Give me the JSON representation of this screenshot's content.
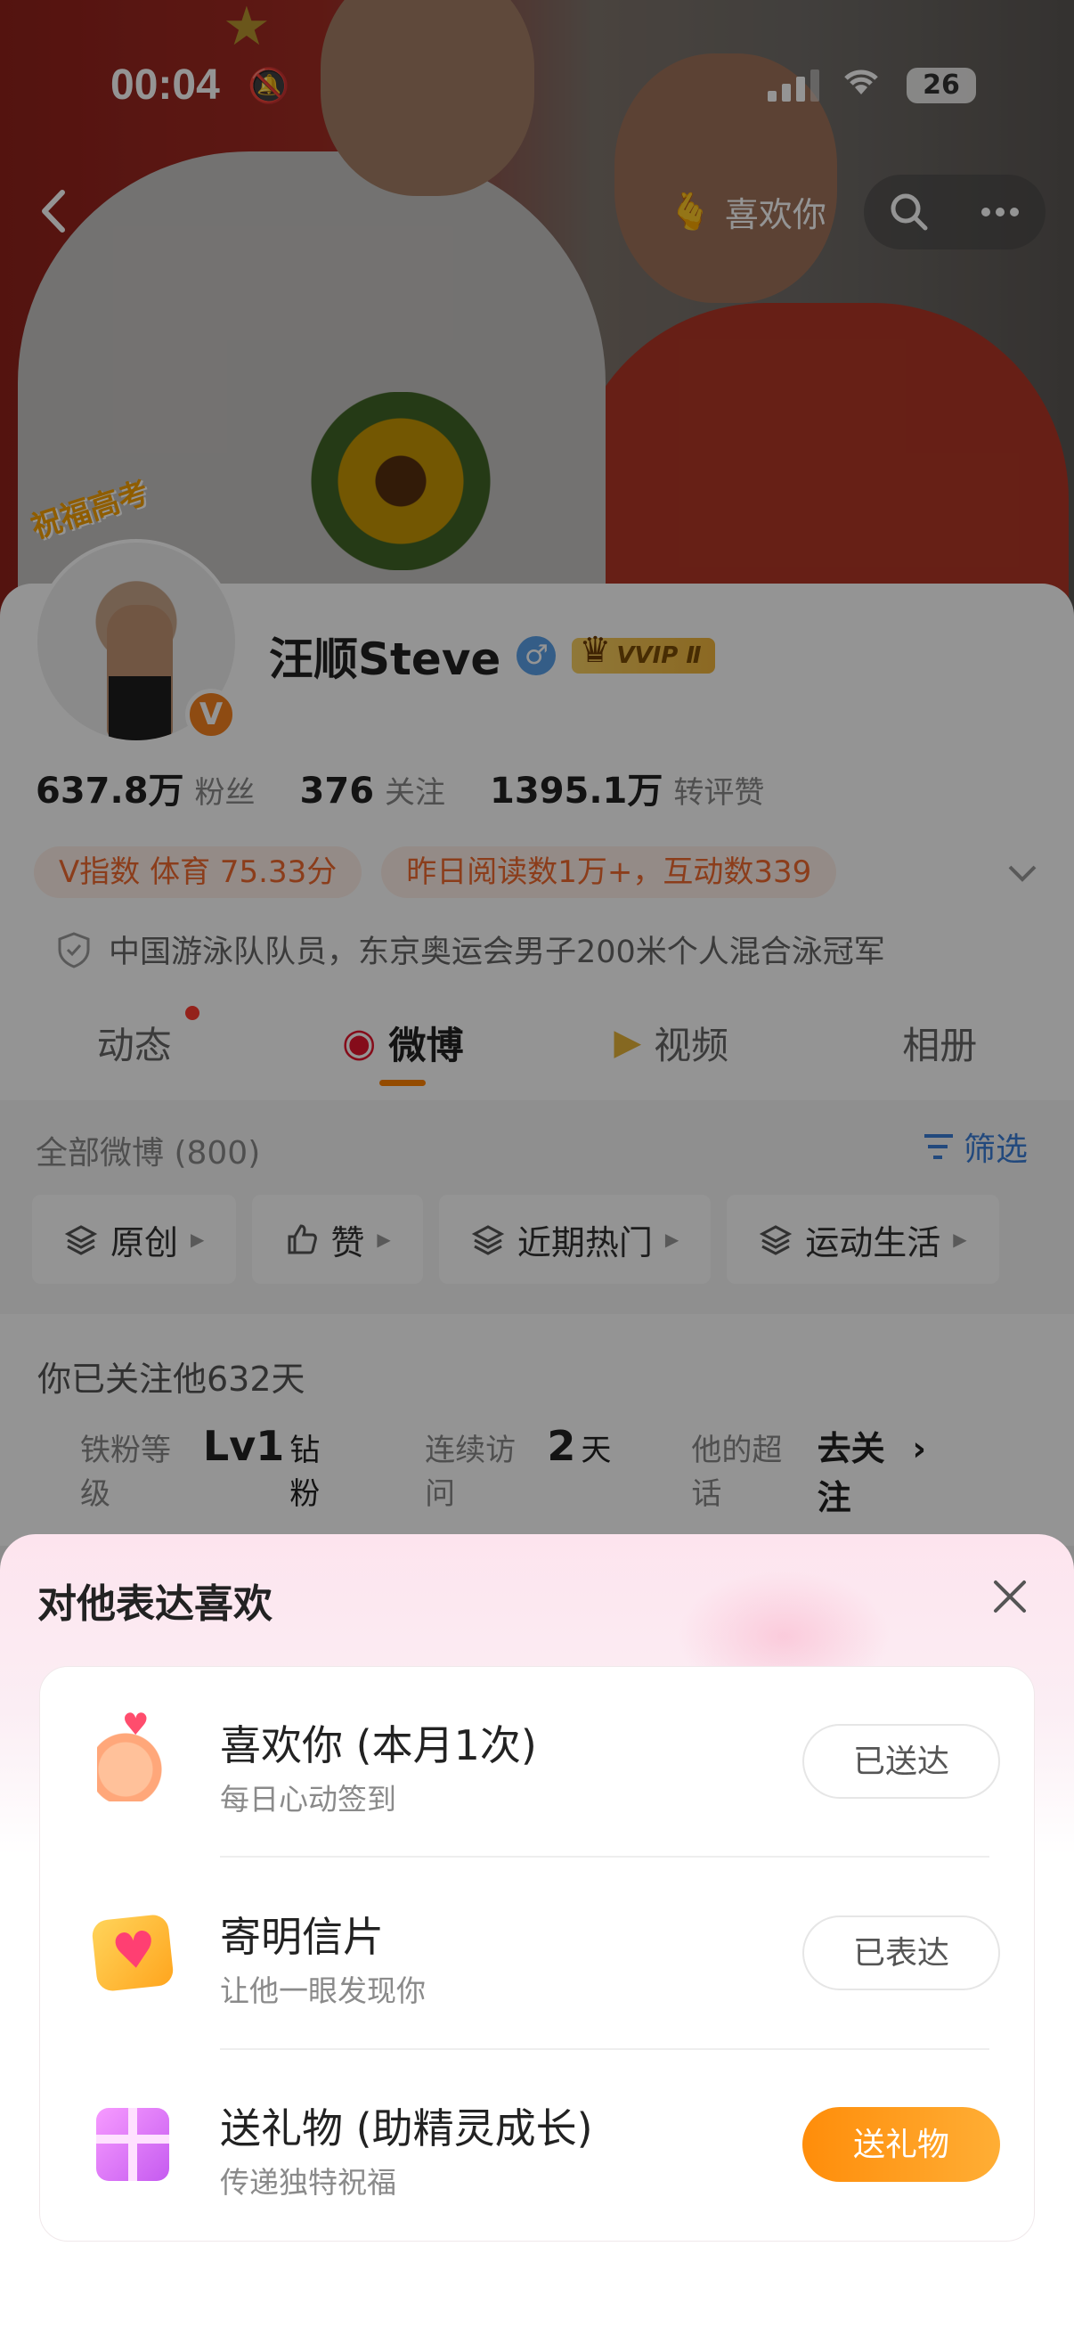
{
  "status_bar": {
    "time": "00:04",
    "battery": "26"
  },
  "header": {
    "like_label": "喜欢你"
  },
  "profile": {
    "avatar_tag": "祝福高考",
    "verified_badge": "V",
    "name": "汪顺Steve",
    "gender_symbol": "♂",
    "vip_label": "VVIP Ⅱ",
    "stats": [
      {
        "num": "637.8万",
        "label": "粉丝"
      },
      {
        "num": "376",
        "label": "关注"
      },
      {
        "num": "1395.1万",
        "label": "转评赞"
      }
    ],
    "tags": [
      "V指数 体育 75.33分",
      "昨日阅读数1万+，互动数339"
    ],
    "certification": "中国游泳队队员，东京奥运会男子200米个人混合泳冠军",
    "tabs": [
      "动态",
      "微博",
      "视频",
      "相册"
    ]
  },
  "feed_filter": {
    "all_label": "全部微博 (800)",
    "filter_label": "筛选",
    "chips": [
      "原创",
      "赞",
      "近期热门",
      "运动生活"
    ]
  },
  "follow_info": {
    "days_label": "你已关注他632天",
    "iron_fan_key": "铁粉等级",
    "iron_fan_level": "Lv1",
    "iron_fan_unit": "钻粉",
    "visit_key": "连续访问",
    "visit_days": "2",
    "visit_unit": "天",
    "topic_key": "他的超话",
    "topic_action": "去关注"
  },
  "sheet": {
    "title": "对他表达喜欢",
    "items": [
      {
        "title": "喜欢你 (本月1次)",
        "subtitle": "每日心动签到",
        "button": "已送达",
        "icon": "finger-heart-icon"
      },
      {
        "title": "寄明信片",
        "subtitle": "让他一眼发现你",
        "button": "已表达",
        "icon": "postcard-heart-icon"
      },
      {
        "title": "送礼物 (助精灵成长)",
        "subtitle": "传递独特祝福",
        "button": "送礼物",
        "icon": "gift-box-icon"
      }
    ]
  },
  "colors": {
    "accent": "#ff8200",
    "link": "#3b7fd8",
    "tag_text": "#f06a30",
    "primary_button": "#ff9a1a"
  }
}
